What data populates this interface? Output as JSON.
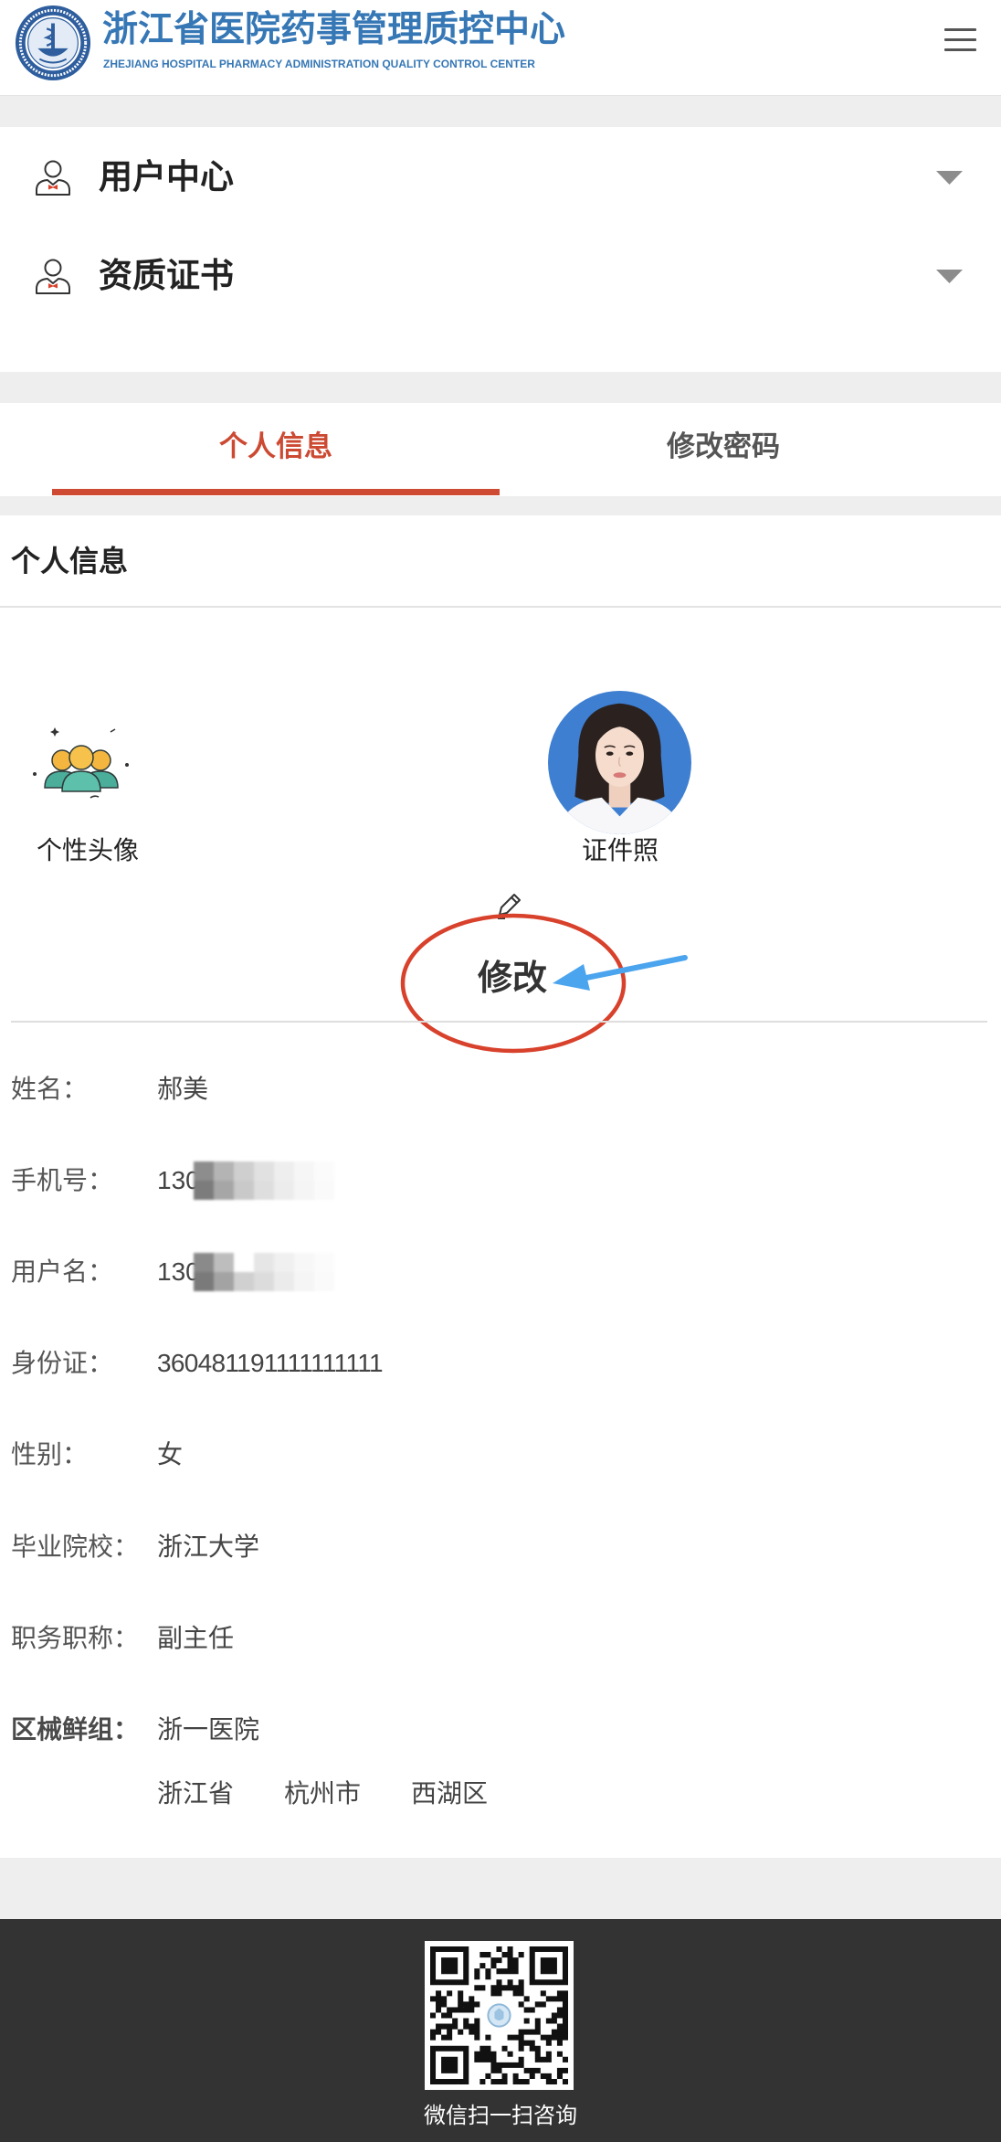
{
  "header": {
    "title": "浙江省医院药事管理质控中心",
    "subtitle": "ZHEJIANG HOSPITAL PHARMACY ADMINISTRATION QUALITY CONTROL CENTER",
    "logo_icon": "hospital-seal-logo",
    "menu_icon": "hamburger-menu-icon"
  },
  "nav_menu": {
    "items": [
      {
        "label": "用户中心",
        "icon": "user-icon",
        "expand_icon": "triangle-down-icon"
      },
      {
        "label": "资质证书",
        "icon": "user-icon",
        "expand_icon": "triangle-down-icon"
      }
    ]
  },
  "tabs": [
    {
      "label": "个人信息",
      "active": true
    },
    {
      "label": "修改密码",
      "active": false
    }
  ],
  "profile_section": {
    "title": "个人信息",
    "avatar": {
      "label": "个性头像",
      "icon": "people-group-icon"
    },
    "id_photo": {
      "label": "证件照"
    },
    "edit": {
      "label": "修改",
      "icon": "pencil-icon"
    },
    "fields": [
      {
        "label": "姓名：",
        "value": "郝美"
      },
      {
        "label": "手机号：",
        "value": "130"
      },
      {
        "label": "用户名：",
        "value": "130"
      },
      {
        "label": "身份证：",
        "value": "360481191111111111"
      },
      {
        "label": "性别：",
        "value": "女"
      },
      {
        "label": "毕业院校：",
        "value": "浙江大学"
      },
      {
        "label": "职务职称：",
        "value": "副主任"
      },
      {
        "label": "区械鲜组：",
        "value": "浙一医院"
      }
    ],
    "region": [
      "浙江省",
      "杭州市",
      "西湖区"
    ]
  },
  "footer": {
    "qr_icon": "wechat-qr-code",
    "caption": "微信扫一扫咨询"
  },
  "colors": {
    "brand_blue": "#3677b5",
    "active_tab_red": "#cc4932",
    "annotation_red": "#d8412b",
    "annotation_blue": "#4ba4ee",
    "footer_bg": "#333333",
    "page_bg": "#eeeeee"
  }
}
